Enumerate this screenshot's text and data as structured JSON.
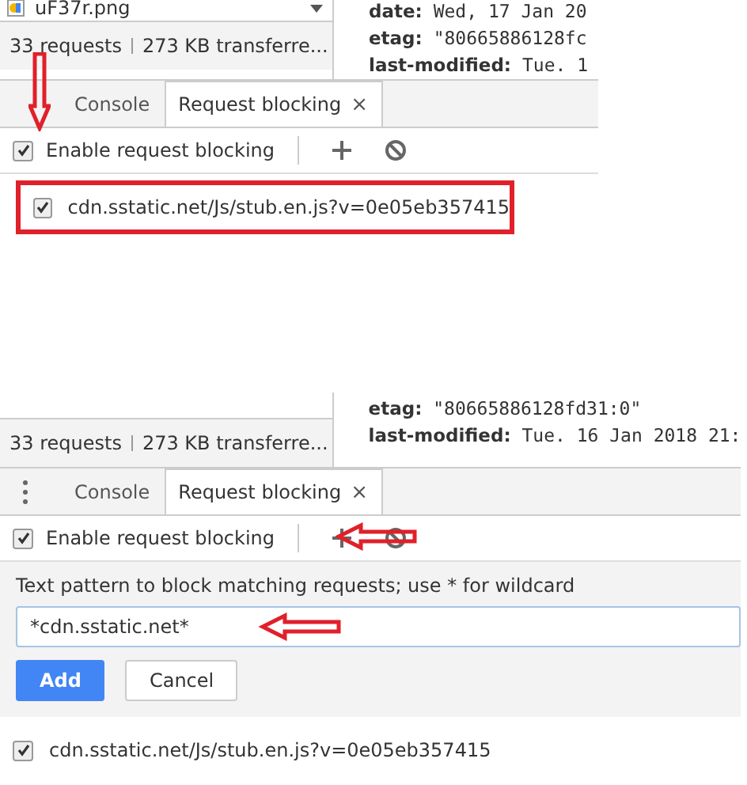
{
  "panels": [
    {
      "file_row": {
        "name": "uF37r.png"
      },
      "summary": {
        "requests": "33 requests",
        "transferred": "273 KB transferre..."
      },
      "headers": [
        {
          "name": "date:",
          "value": "Wed, 17 Jan 20"
        },
        {
          "name": "etag:",
          "value": "\"80665886128fc"
        },
        {
          "name": "last-modified:",
          "value": "Tue. 1"
        }
      ],
      "menu_visible": false,
      "tabs": [
        {
          "label": "Console",
          "selected": false
        },
        {
          "label": "Request blocking",
          "selected": true,
          "close": "×"
        }
      ],
      "toolbar": {
        "label": "Enable request blocking",
        "checked": true,
        "arrow_to_checkbox": true,
        "arrow_to_add": false
      },
      "patterns": [
        {
          "text": "cdn.sstatic.net/Js/stub.en.js?v=0e05eb357415",
          "checked": true,
          "highlighted": true
        }
      ]
    },
    {
      "summary": {
        "requests": "33 requests",
        "transferred": "273 KB transferre..."
      },
      "headers": [
        {
          "name": "etag:",
          "value": "\"80665886128fd31:0\""
        },
        {
          "name": "last-modified:",
          "value": "Tue. 16 Jan 2018 21:"
        }
      ],
      "menu_visible": true,
      "tabs": [
        {
          "label": "Console",
          "selected": false
        },
        {
          "label": "Request blocking",
          "selected": true,
          "close": "×"
        }
      ],
      "toolbar": {
        "label": "Enable request blocking",
        "checked": true,
        "arrow_to_checkbox": false,
        "arrow_to_add": true
      },
      "form": {
        "label": "Text pattern to block matching requests; use * for wildcard",
        "value": "*cdn.sstatic.net*",
        "arrow": true,
        "buttons": [
          {
            "label": "Add",
            "kind": "primary"
          },
          {
            "label": "Cancel",
            "kind": "secondary"
          }
        ]
      },
      "patterns": [
        {
          "text": "cdn.sstatic.net/Js/stub.en.js?v=0e05eb357415",
          "checked": true,
          "highlighted": false
        }
      ]
    }
  ]
}
